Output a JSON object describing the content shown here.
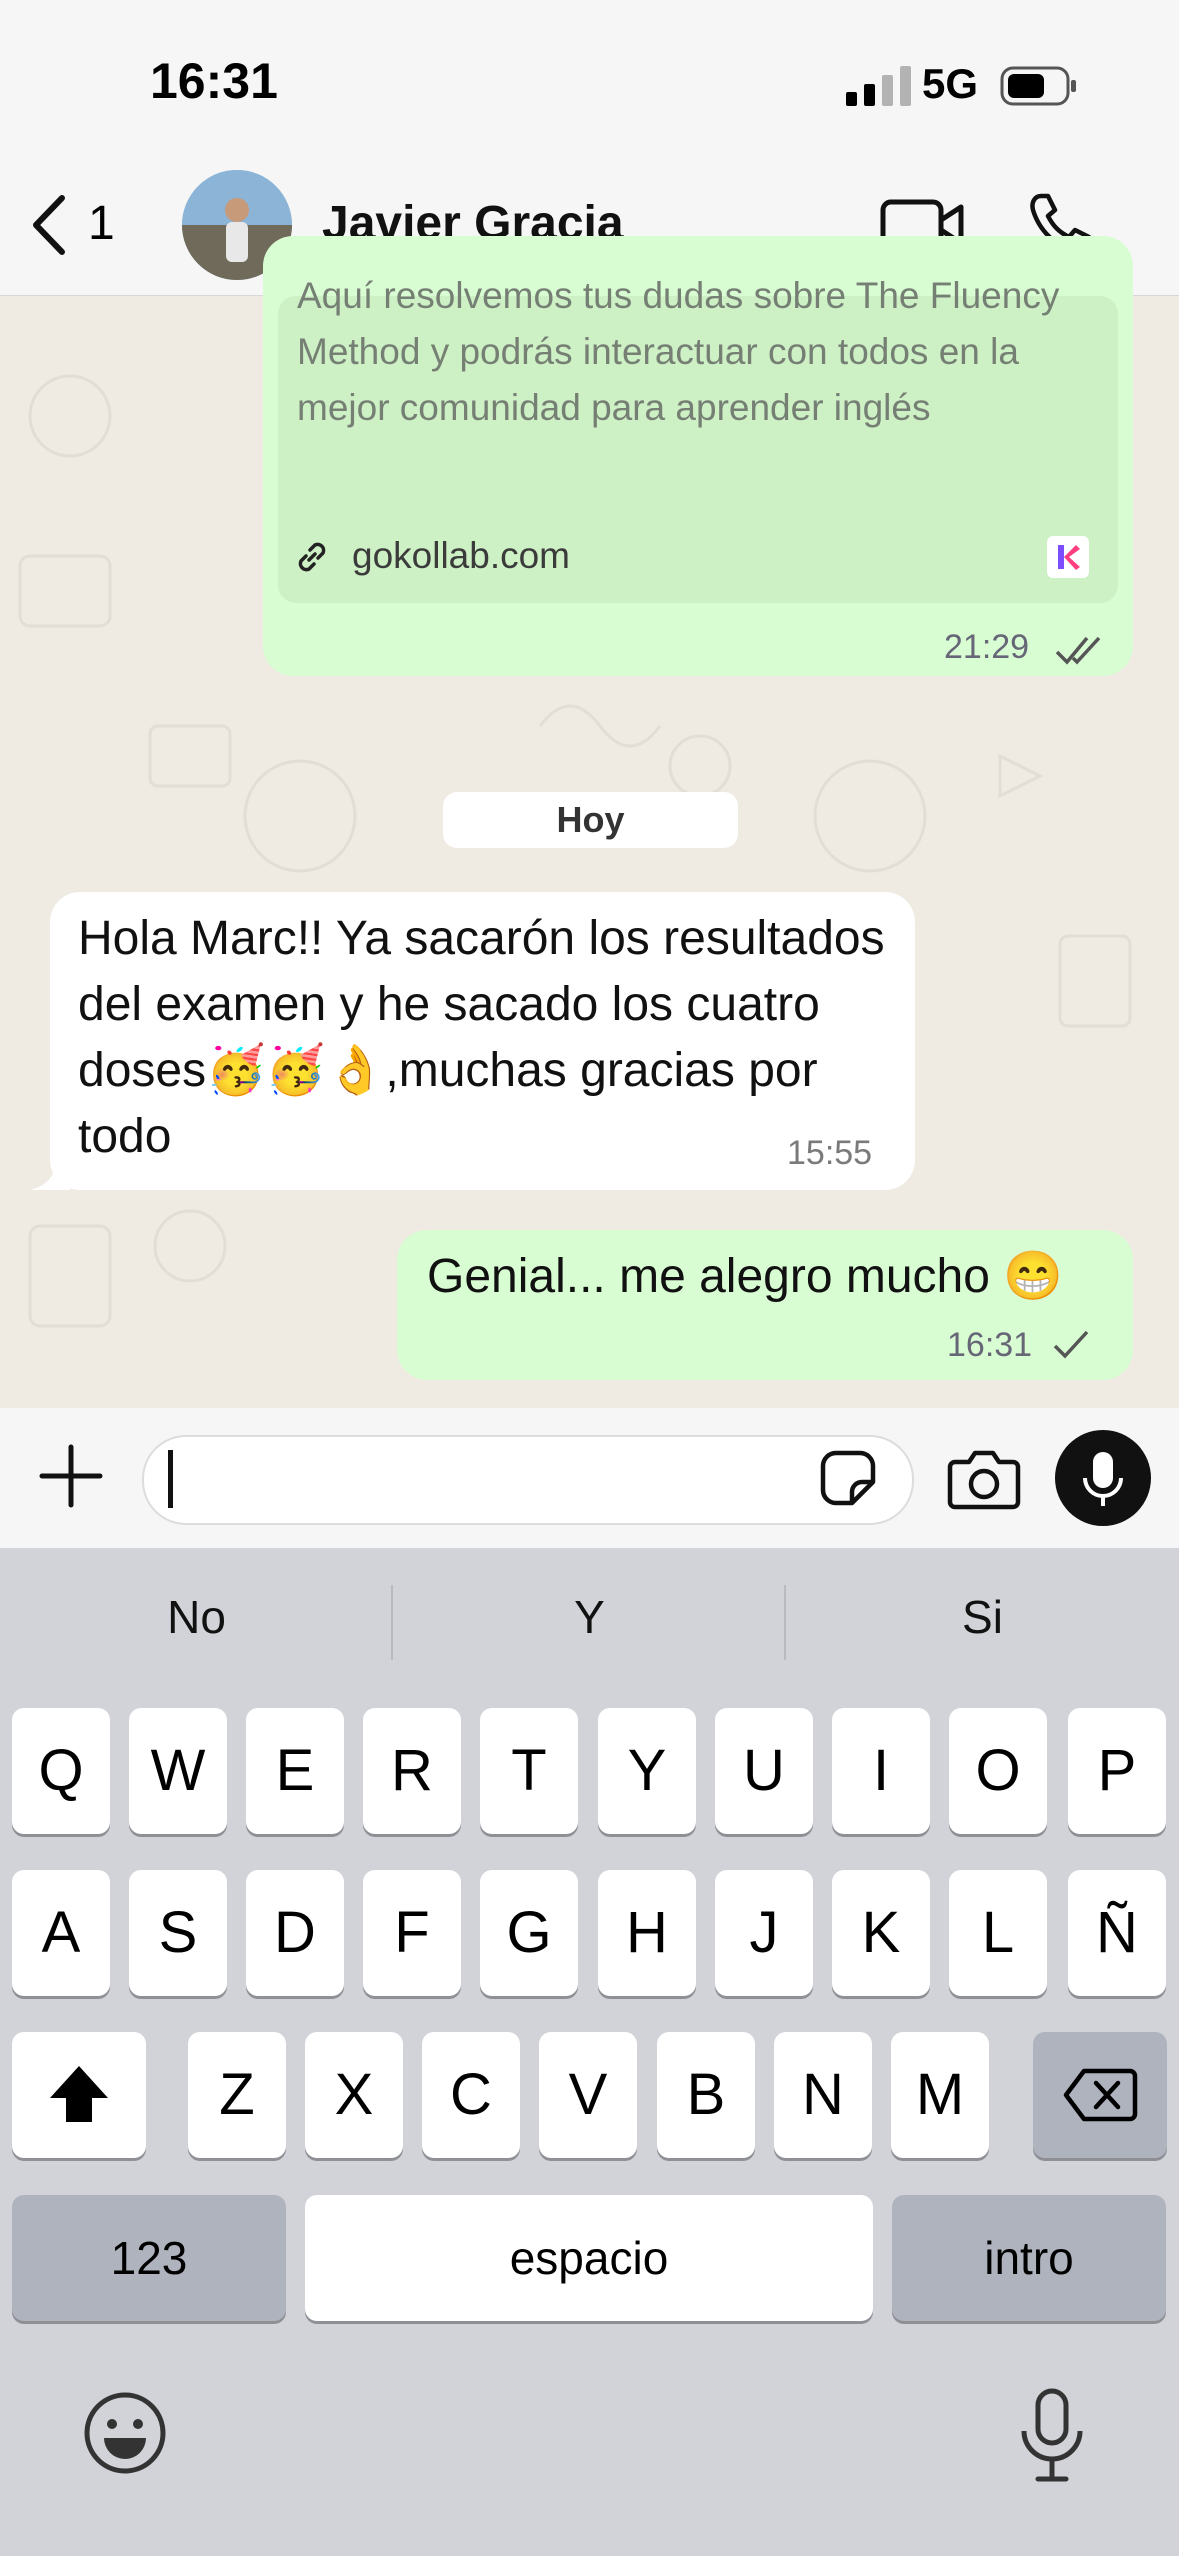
{
  "status_bar": {
    "time": "16:31",
    "network": "5G"
  },
  "header": {
    "unread_count": "1",
    "contact_name": "Javier Gracia"
  },
  "colors": {
    "outgoing_bubble": "#d9fdd3",
    "incoming_bubble": "#ffffff",
    "chat_background": "#efeae2",
    "keyboard_background": "#d1d3d9"
  },
  "messages": {
    "previous": {
      "description": "Aquí resolvemos tus dudas sobre The Fluency Method y podrás interactuar con todos en la mejor comunidad para aprender inglés",
      "link": "gokollab.com",
      "time": "21:29"
    },
    "day_separator": "Hoy",
    "incoming": {
      "text": "Hola Marc!! Ya sacarón los resultados del examen y he sacado los  cuatro doses🥳🥳👌,muchas gracias por todo",
      "time": "15:55"
    },
    "outgoing": {
      "text": "Genial... me alegro mucho 😁",
      "time": "16:31"
    }
  },
  "input": {
    "value": ""
  },
  "keyboard": {
    "suggestions": [
      "No",
      "Y",
      "Si"
    ],
    "row1": [
      "Q",
      "W",
      "E",
      "R",
      "T",
      "Y",
      "U",
      "I",
      "O",
      "P"
    ],
    "row2": [
      "A",
      "S",
      "D",
      "F",
      "G",
      "H",
      "J",
      "K",
      "L",
      "Ñ"
    ],
    "row3": [
      "Z",
      "X",
      "C",
      "V",
      "B",
      "N",
      "M"
    ],
    "numbers_key": "123",
    "space_key": "espacio",
    "return_key": "intro"
  }
}
